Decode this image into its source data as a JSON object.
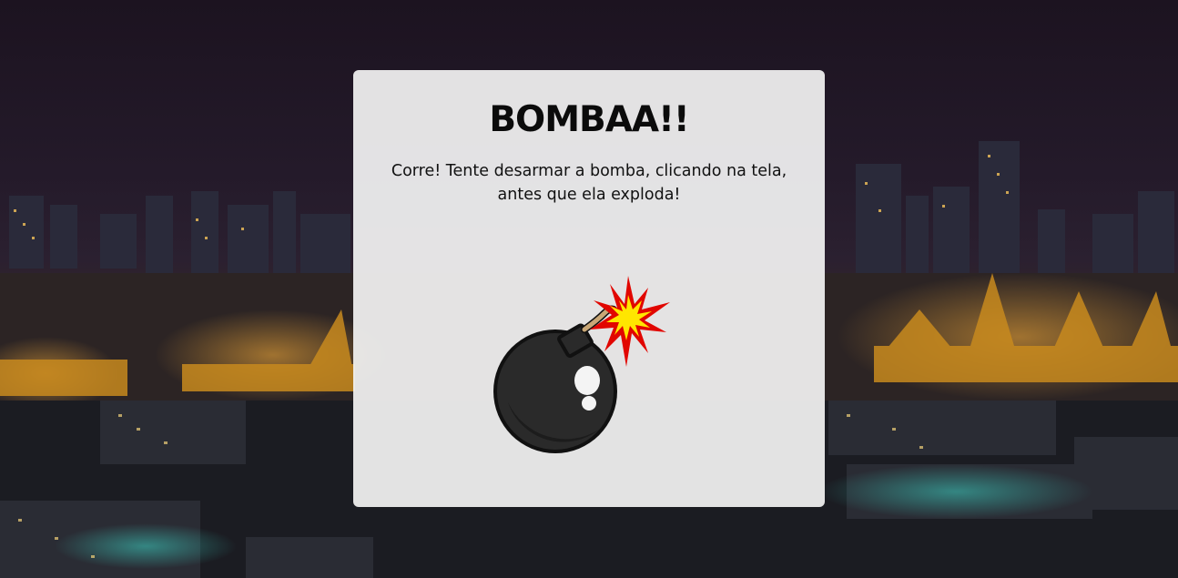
{
  "page": {
    "title": "BOMBAA!!",
    "message_line1": "Corre! Tente desarmar a bomba, clicando na tela,",
    "message_line2": "antes que ela exploda!"
  },
  "bomb": {
    "icon": "bomb-icon",
    "spark_icon": "spark-icon"
  },
  "background": {
    "image": "night-city-skyline"
  },
  "colors": {
    "card": "#f2f2f2",
    "text": "#111111",
    "bomb": "#2a2a2a",
    "spark_red": "#e10600",
    "spark_yellow": "#ffe600"
  }
}
